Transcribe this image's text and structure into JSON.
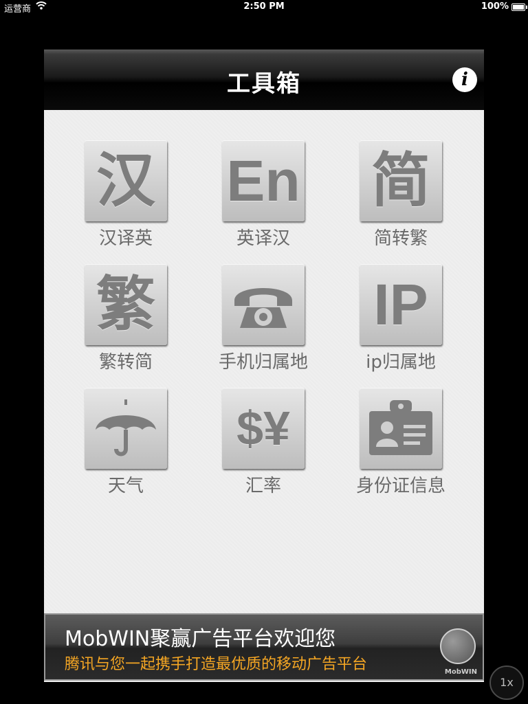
{
  "status_bar": {
    "carrier": "运营商",
    "time": "2:50 PM",
    "battery": "100%",
    "battery_level": 1.0
  },
  "navbar": {
    "title": "工具箱",
    "info_icon": "info-icon",
    "info_glyph": "i"
  },
  "tools": [
    {
      "glyph": "汉",
      "label": "汉译英",
      "icon": "han-char-icon"
    },
    {
      "glyph": "En",
      "label": "英译汉",
      "icon": "en-text-icon"
    },
    {
      "glyph": "简",
      "label": "简转繁",
      "icon": "jian-char-icon"
    },
    {
      "glyph": "繁",
      "label": "繁转简",
      "icon": "fan-char-icon"
    },
    {
      "glyph": "",
      "label": "手机归属地",
      "icon": "telephone-icon"
    },
    {
      "glyph": "IP",
      "label": "ip归属地",
      "icon": "ip-text-icon"
    },
    {
      "glyph": "",
      "label": "天气",
      "icon": "umbrella-icon"
    },
    {
      "glyph": "$¥",
      "label": "汇率",
      "icon": "currency-icon"
    },
    {
      "glyph": "",
      "label": "身份证信息",
      "icon": "id-card-icon"
    }
  ],
  "ad": {
    "headline": "MobWIN聚赢广告平台欢迎您",
    "subtext": "腾讯与您一起携手打造最优质的移动广告平台",
    "brand": "MobWIN",
    "icon": "globe-icon",
    "subtext_color": "#f5a623"
  },
  "zoom_button": "1x"
}
